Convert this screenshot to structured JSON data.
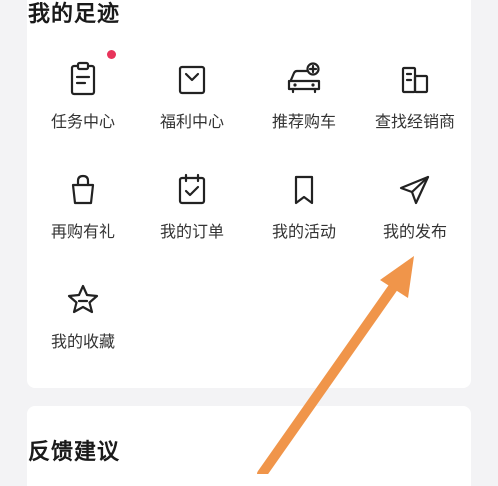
{
  "footprint": {
    "title": "我的足迹",
    "items": [
      {
        "label": "任务中心",
        "icon": "task-center-icon"
      },
      {
        "label": "福利中心",
        "icon": "welfare-center-icon"
      },
      {
        "label": "推荐购车",
        "icon": "recommend-car-icon"
      },
      {
        "label": "查找经销商",
        "icon": "find-dealer-icon"
      },
      {
        "label": "再购有礼",
        "icon": "repurchase-gift-icon"
      },
      {
        "label": "我的订单",
        "icon": "my-orders-icon"
      },
      {
        "label": "我的活动",
        "icon": "my-activities-icon"
      },
      {
        "label": "我的发布",
        "icon": "my-posts-icon"
      },
      {
        "label": "我的收藏",
        "icon": "my-favorites-icon"
      }
    ]
  },
  "feedback": {
    "title": "反馈建议"
  },
  "colors": {
    "badge": "#e8345b",
    "annotation_arrow": "#f0954a",
    "background": "#f3f3f5",
    "card": "#ffffff"
  }
}
